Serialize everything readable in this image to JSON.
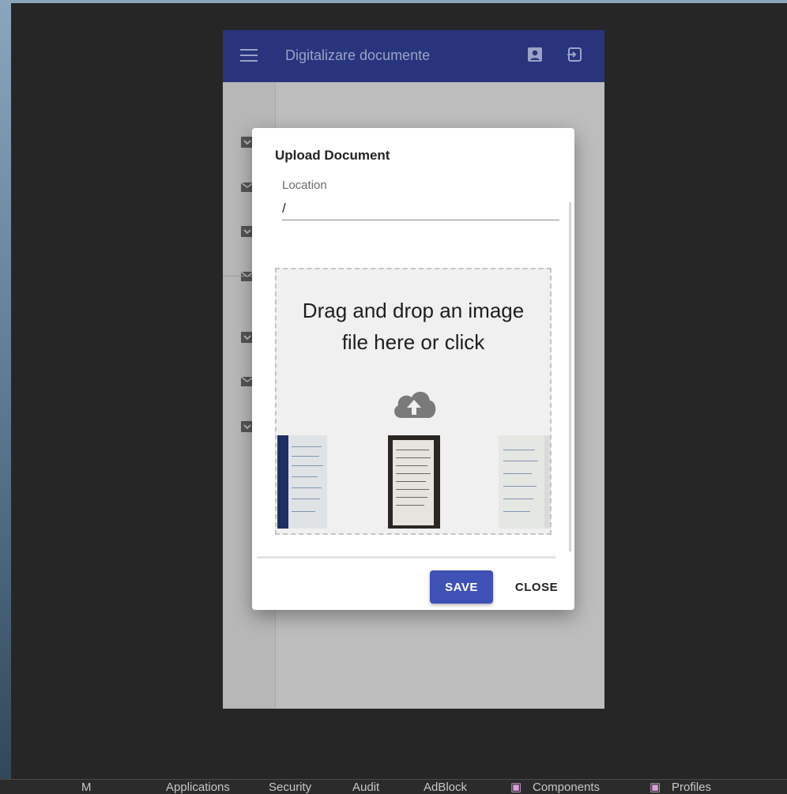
{
  "app": {
    "title": "Digitalizare documente"
  },
  "dialog": {
    "title": "Upload Document",
    "location_label": "Location",
    "location_value": "/",
    "dropzone_text_line1": "Drag and drop an image",
    "dropzone_text_line2": "file here or click",
    "thumbnails": [
      "document-photo-1",
      "document-photo-2",
      "document-photo-3"
    ],
    "save_label": "SAVE",
    "close_label": "CLOSE"
  },
  "taskbar": {
    "items": [
      "M",
      "Applications",
      "Security",
      "Audit",
      "AdBlock",
      "Components",
      "Profiles"
    ]
  },
  "colors": {
    "appbar": "#28347c",
    "save_button": "#3f51b5",
    "background": "#262626"
  },
  "icons": {
    "menu": "hamburger-icon",
    "profile": "account-box-icon",
    "logout": "exit-icon",
    "upload": "cloud-upload-icon",
    "sidebar": [
      "inbox-icon",
      "mail-icon",
      "inbox-icon",
      "mail-icon",
      "inbox-icon",
      "mail-icon",
      "inbox-icon"
    ]
  }
}
